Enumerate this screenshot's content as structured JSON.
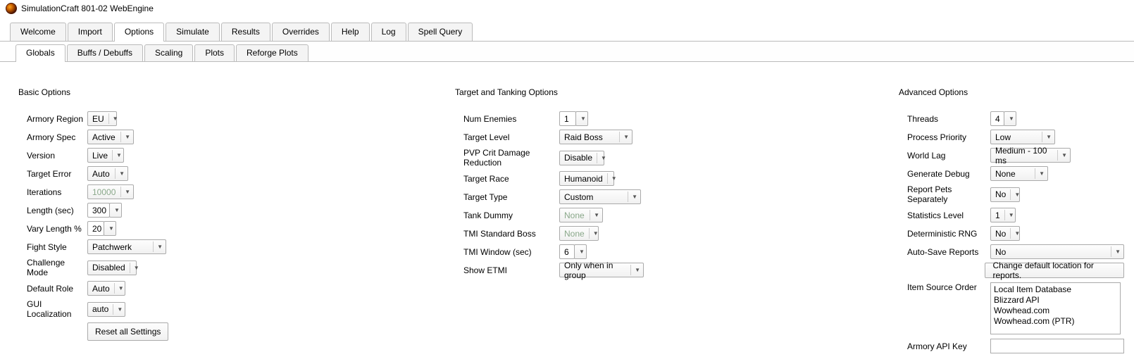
{
  "window": {
    "title": "SimulationCraft 801-02 WebEngine"
  },
  "tabs": {
    "items": [
      "Welcome",
      "Import",
      "Options",
      "Simulate",
      "Results",
      "Overrides",
      "Help",
      "Log",
      "Spell Query"
    ],
    "active": "Options"
  },
  "subtabs": {
    "items": [
      "Globals",
      "Buffs / Debuffs",
      "Scaling",
      "Plots",
      "Reforge Plots"
    ],
    "active": "Globals"
  },
  "basic": {
    "title": "Basic Options",
    "armory_region": {
      "label": "Armory Region",
      "value": "EU"
    },
    "armory_spec": {
      "label": "Armory Spec",
      "value": "Active"
    },
    "version": {
      "label": "Version",
      "value": "Live"
    },
    "target_error": {
      "label": "Target Error",
      "value": "Auto"
    },
    "iterations": {
      "label": "Iterations",
      "value": "10000"
    },
    "length_sec": {
      "label": "Length (sec)",
      "value": "300"
    },
    "vary_length": {
      "label": "Vary Length %",
      "value": "20"
    },
    "fight_style": {
      "label": "Fight Style",
      "value": "Patchwerk"
    },
    "challenge_mode": {
      "label": "Challenge Mode",
      "value": "Disabled"
    },
    "default_role": {
      "label": "Default Role",
      "value": "Auto"
    },
    "gui_local": {
      "label": "GUI Localization",
      "value": "auto"
    },
    "reset_button": "Reset all Settings"
  },
  "target": {
    "title": "Target and Tanking Options",
    "num_enemies": {
      "label": "Num Enemies",
      "value": "1"
    },
    "target_level": {
      "label": "Target Level",
      "value": "Raid Boss"
    },
    "pvp_crit": {
      "label": "PVP Crit Damage Reduction",
      "value": "Disable"
    },
    "target_race": {
      "label": "Target Race",
      "value": "Humanoid"
    },
    "target_type": {
      "label": "Target Type",
      "value": "Custom"
    },
    "tank_dummy": {
      "label": "Tank Dummy",
      "value": "None"
    },
    "tmi_std_boss": {
      "label": "TMI Standard Boss",
      "value": "None"
    },
    "tmi_window": {
      "label": "TMI Window (sec)",
      "value": "6"
    },
    "show_etmi": {
      "label": "Show ETMI",
      "value": "Only when in group"
    }
  },
  "advanced": {
    "title": "Advanced Options",
    "threads": {
      "label": "Threads",
      "value": "4"
    },
    "process_prio": {
      "label": "Process Priority",
      "value": "Low"
    },
    "world_lag": {
      "label": "World Lag",
      "value": "Medium - 100 ms"
    },
    "gen_debug": {
      "label": "Generate Debug",
      "value": "None"
    },
    "report_pets": {
      "label": "Report Pets Separately",
      "value": "No"
    },
    "stats_level": {
      "label": "Statistics Level",
      "value": "1"
    },
    "det_rng": {
      "label": "Deterministic RNG",
      "value": "No"
    },
    "auto_save": {
      "label": "Auto-Save Reports",
      "value": "No"
    },
    "change_loc_btn": "Change default location for reports.",
    "item_src": {
      "label": "Item Source Order",
      "items": [
        "Local Item Database",
        "Blizzard API",
        "Wowhead.com",
        "Wowhead.com (PTR)"
      ]
    },
    "armory_key": {
      "label": "Armory API Key",
      "value": ""
    }
  }
}
